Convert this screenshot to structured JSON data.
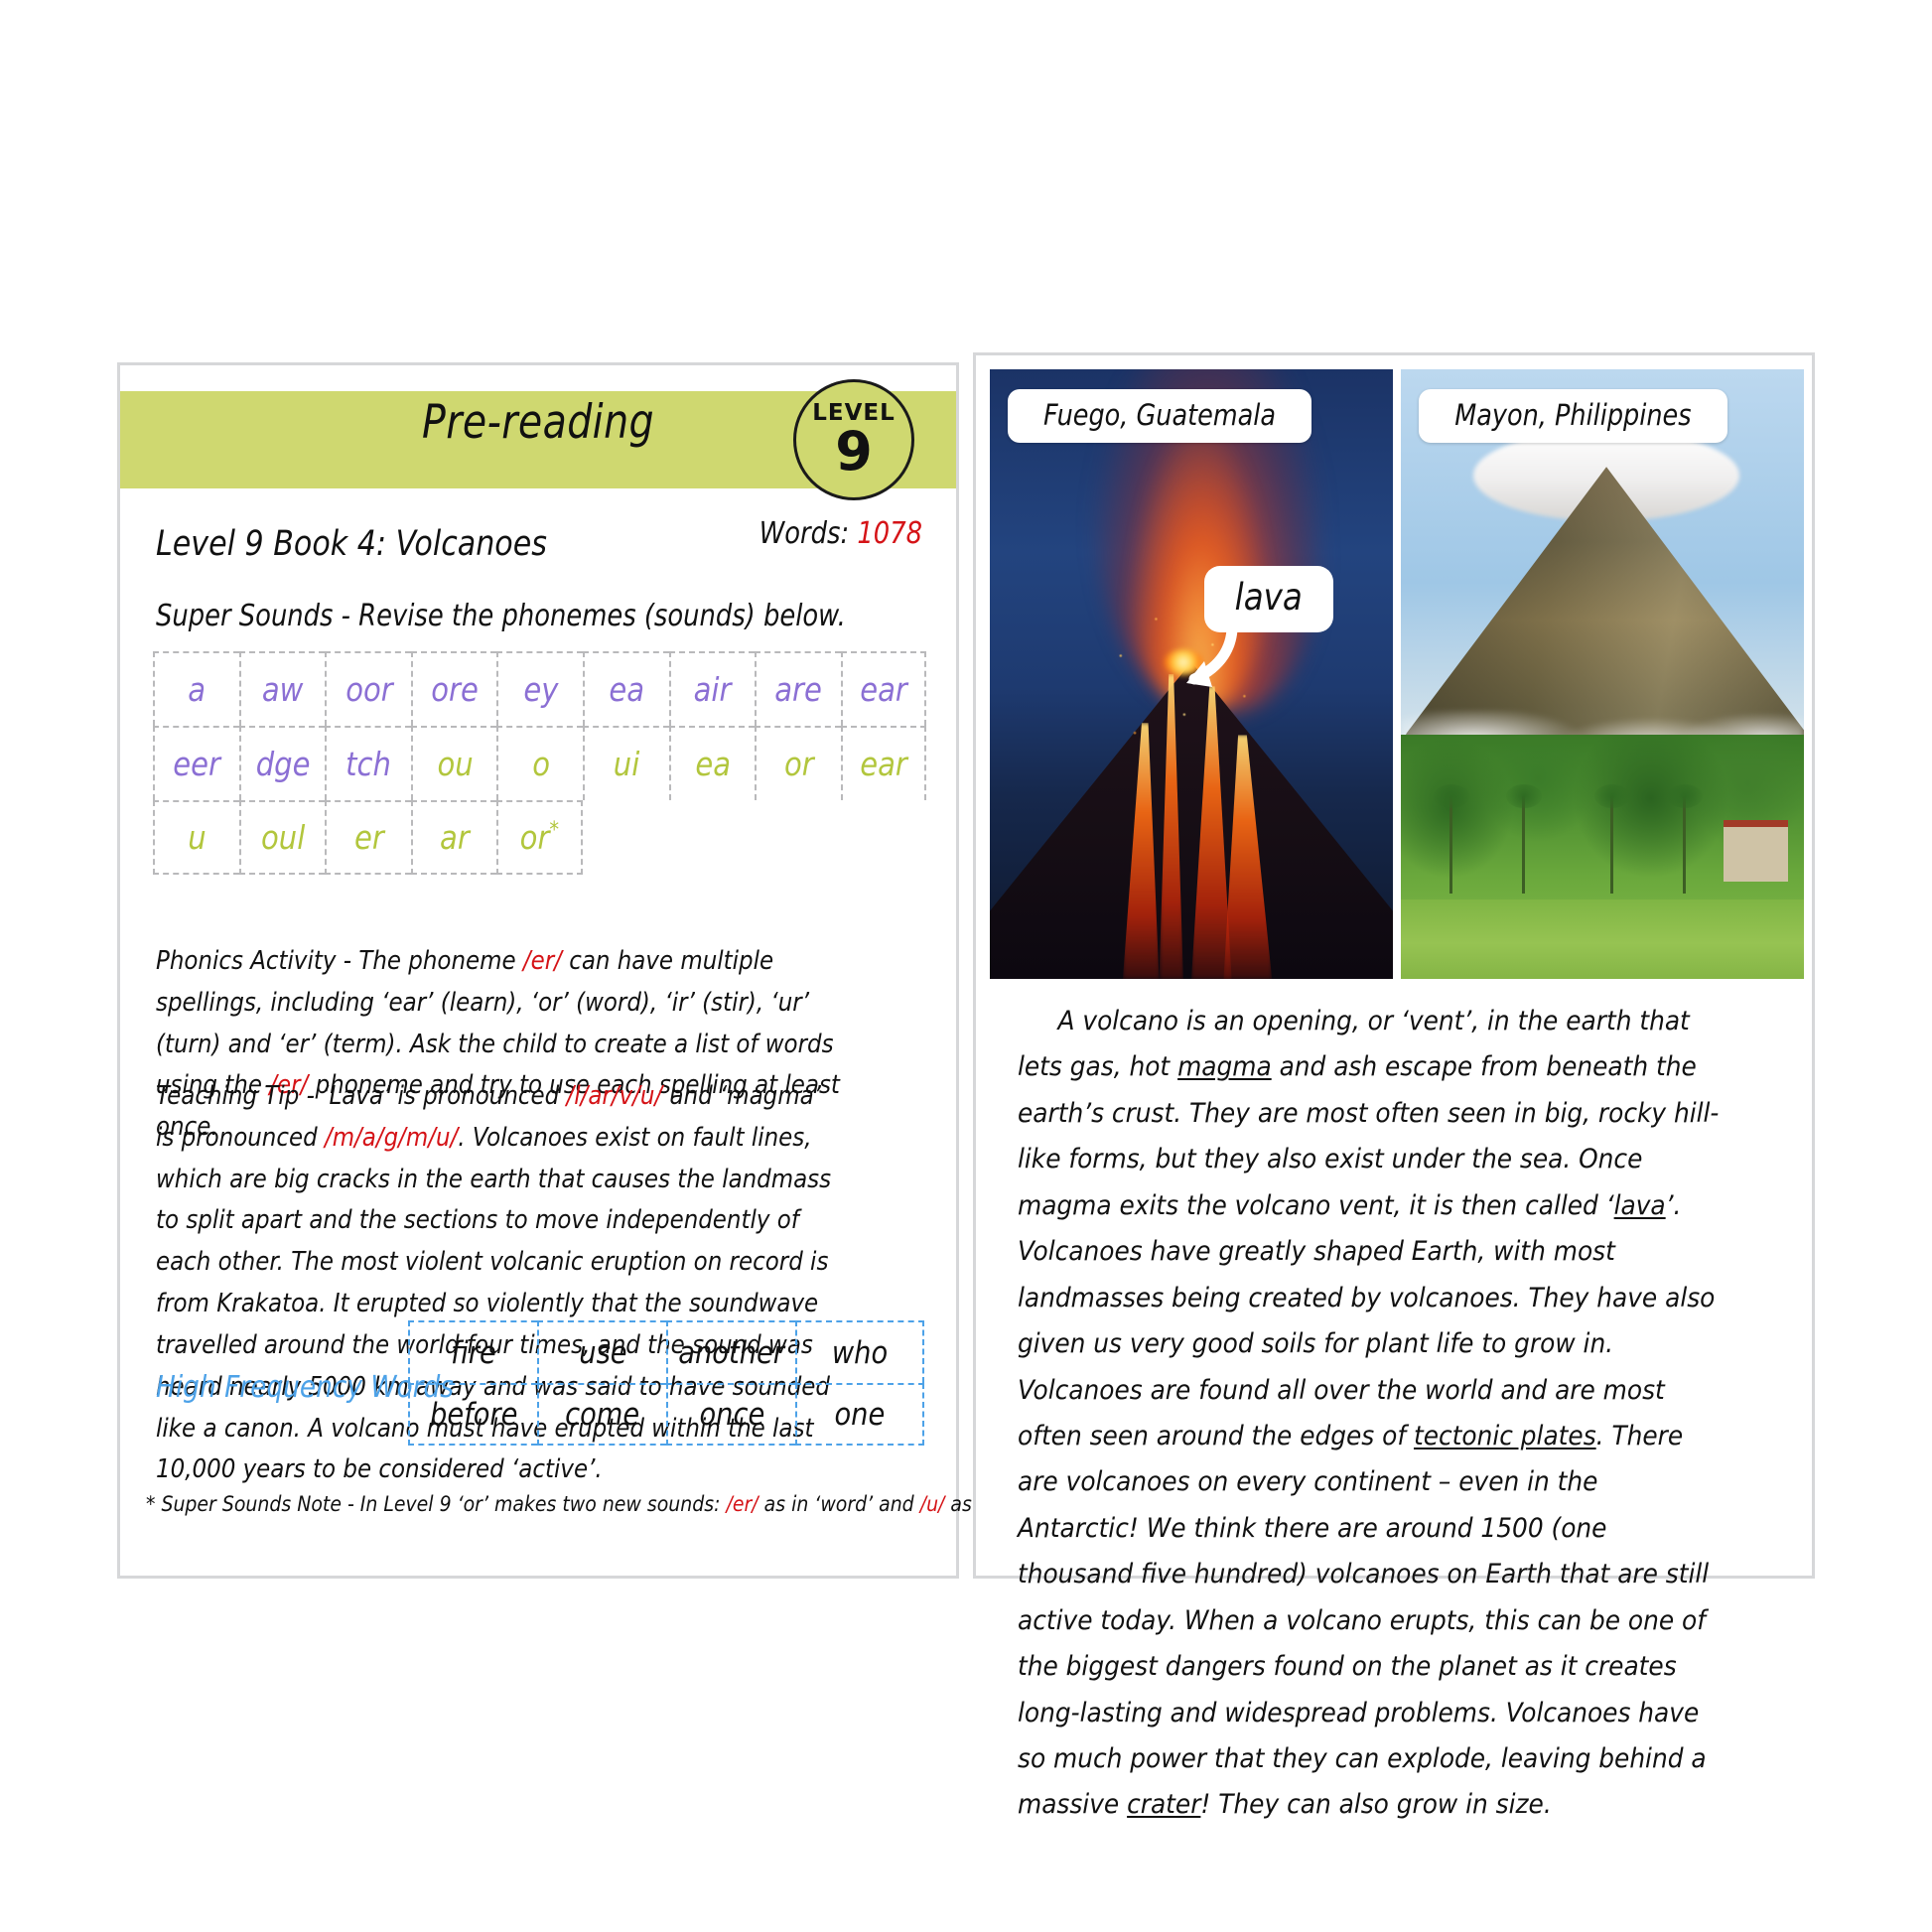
{
  "left_panel": {
    "band_title": "Pre-reading",
    "level_badge": {
      "word": "LEVEL",
      "number": "9"
    },
    "words_label": "Words: ",
    "words_count": "1078",
    "book_title": "Level 9 Book 4: Volcanoes",
    "super_sounds_line": "Super Sounds - Revise the phonemes (sounds) below.",
    "phoneme_rows": [
      [
        {
          "text": "a",
          "color": "purple"
        },
        {
          "text": "aw",
          "color": "purple"
        },
        {
          "text": "oor",
          "color": "purple"
        },
        {
          "text": "ore",
          "color": "purple"
        },
        {
          "text": "ey",
          "color": "purple"
        },
        {
          "text": "ea",
          "color": "purple"
        },
        {
          "text": "air",
          "color": "purple"
        },
        {
          "text": "are",
          "color": "purple"
        },
        {
          "text": "ear",
          "color": "purple"
        }
      ],
      [
        {
          "text": "eer",
          "color": "purple"
        },
        {
          "text": "dge",
          "color": "purple"
        },
        {
          "text": "tch",
          "color": "purple"
        },
        {
          "text": "ou",
          "color": "green"
        },
        {
          "text": "o",
          "color": "green"
        },
        {
          "text": "ui",
          "color": "green"
        },
        {
          "text": "ea",
          "color": "green"
        },
        {
          "text": "or",
          "color": "green"
        },
        {
          "text": "ear",
          "color": "green"
        }
      ],
      [
        {
          "text": "u",
          "color": "green"
        },
        {
          "text": "oul",
          "color": "green"
        },
        {
          "text": "er",
          "color": "green"
        },
        {
          "text": "ar",
          "color": "green"
        },
        {
          "text": "or",
          "color": "green",
          "star": "*"
        }
      ]
    ],
    "phonics_activity": {
      "lead": "Phonics Activity - The phoneme ",
      "phoneme_1": "/er/",
      "mid": " can have multiple spellings, including ‘ear’ (learn), ‘or’ (word), ‘ir’ (stir), ‘ur’ (turn) and ‘er’ (term). Ask the child to create a list of words using the ",
      "phoneme_2": "/er/",
      "tail": " phoneme and try to use each spelling at least once."
    },
    "teaching_tip": {
      "lead": "Teaching Tip - ‘Lava’ is pronounced ",
      "phoneme_1": "/l/ar/v/u/",
      "mid": " and ‘magma’ is pronounced ",
      "phoneme_2": "/m/a/g/m/u/",
      "tail": ". Volcanoes exist on fault lines, which are big cracks in the earth that causes the landmass to split apart and the sections to move independently of each other. The most violent volcanic eruption on record is from Krakatoa. It erupted so violently that the soundwave travelled around the world four times, and the sound was heard nearly 5000 km away and was said to have sounded like a canon. A volcano must have erupted within the last 10,000 years to be considered ‘active’."
    },
    "hfw_label": "High Frequency Words",
    "hfw_rows": [
      [
        "fire",
        "use",
        "another",
        "who"
      ],
      [
        "before",
        "come",
        "once",
        "one"
      ]
    ],
    "super_sounds_note": {
      "lead": "* Super Sounds Note - In Level 9 ‘or’ makes two new sounds: ",
      "phoneme_1": "/er/",
      "mid": " as in ‘word’ and ",
      "phoneme_2": "/u/",
      "tail": " as in ‘doctor’."
    }
  },
  "right_panel": {
    "photo_left": {
      "caption": "Fuego, Guatemala",
      "alt_name": "erupting-volcano-at-night"
    },
    "photo_right": {
      "caption": "Mayon, Philippines",
      "alt_name": "mayon-volcano-landscape"
    },
    "lava_callout": "lava",
    "body_text": {
      "p1_a": "A volcano is an opening, or ‘vent’, in the earth that lets gas, hot ",
      "u1": "magma",
      "p1_b": " and ash escape from beneath the earth’s crust. They are most often seen in big, rocky hill-like forms, but they also exist under the sea. Once magma exits the volcano vent, it is then called ‘",
      "u2": "lava",
      "p1_c": "’. Volcanoes have greatly shaped Earth, with most landmasses being created by volcanoes. They have also given us very good soils for plant life to grow in. Volcanoes are found all over the world and are most often seen around the edges of ",
      "u3": "tectonic plates",
      "p1_d": ". There are volcanoes on every continent – even in the Antarctic! We think there are around 1500 (one thousand five hundred) volcanoes on Earth that are still active today. When a volcano erupts, this can be one of the biggest dangers found on the planet as it creates long-lasting and widespread problems. Volcanoes have so much power that they can explode, leaving behind a massive ",
      "u4": "crater",
      "p1_e": "! They can also grow in size."
    }
  },
  "colors": {
    "band_green": "#cfd870",
    "phoneme_purple": "#8b6fd4",
    "phoneme_green": "#b2c63d",
    "accent_red": "#d51317",
    "hfw_blue": "#4da2e8",
    "card_border": "#d6d7d9"
  }
}
